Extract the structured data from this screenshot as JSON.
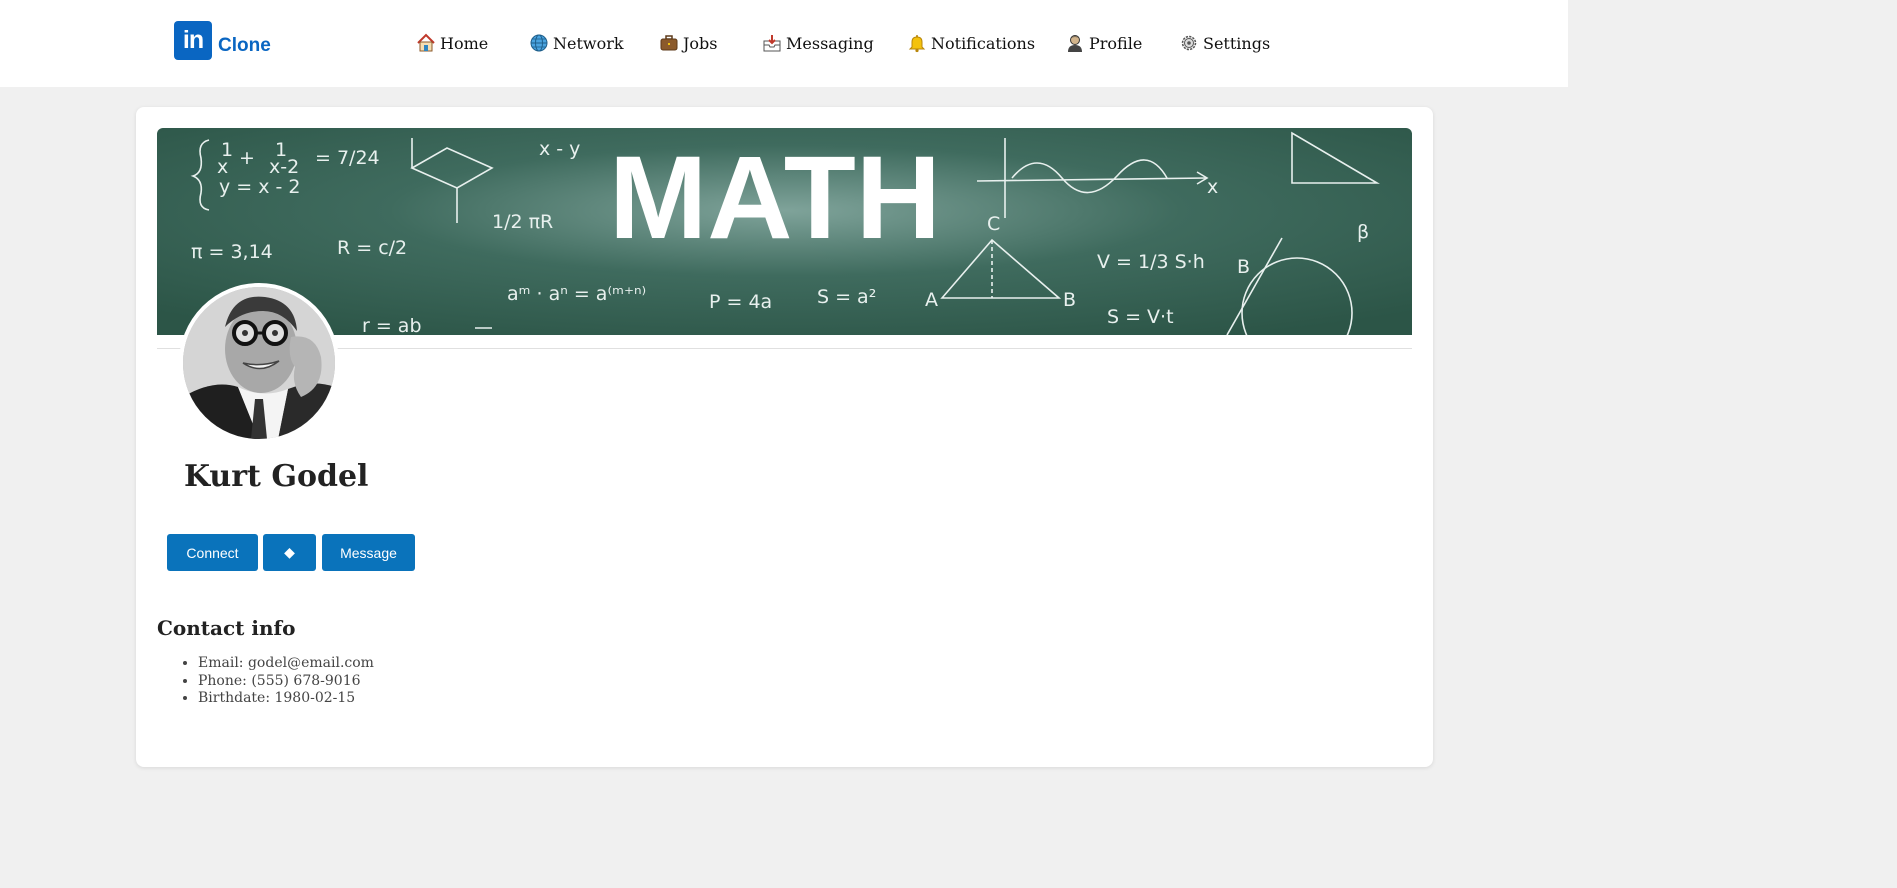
{
  "header": {
    "logo_mark": "in",
    "logo_text": "Clone",
    "brand_color": "#0a66c2",
    "nav": [
      {
        "label": "Home",
        "icon": "house-icon"
      },
      {
        "label": "Network",
        "icon": "globe-icon"
      },
      {
        "label": "Jobs",
        "icon": "briefcase-icon"
      },
      {
        "label": "Messaging",
        "icon": "inbox-tray-icon"
      },
      {
        "label": "Notifications",
        "icon": "bell-icon"
      },
      {
        "label": "Profile",
        "icon": "person-icon"
      },
      {
        "label": "Settings",
        "icon": "gear-icon"
      }
    ]
  },
  "profile": {
    "banner_text": "MATH",
    "banner_formulas": [
      "1/x + 1/(x-2) = 7/24",
      "y = x - 2",
      "π = 3,14",
      "R = c/2",
      "1/2 πR",
      "x - y",
      "aᵐ · aⁿ = a⁽ᵐ⁺ⁿ⁾",
      "P = 4a",
      "S = a²",
      "V = 1/3 S·h",
      "S = V·t",
      "β",
      "r = ab"
    ],
    "name": "Kurt Godel",
    "buttons": {
      "connect": "Connect",
      "more": "◆",
      "message": "Message"
    }
  },
  "contact": {
    "title": "Contact info",
    "items": [
      "Email: godel@email.com",
      "Phone: (555) 678-9016",
      "Birthdate: 1980-02-15"
    ]
  },
  "colors": {
    "button": "#0a73bb",
    "banner": "#2f5a4d",
    "page_bg": "#f0f0f0"
  }
}
